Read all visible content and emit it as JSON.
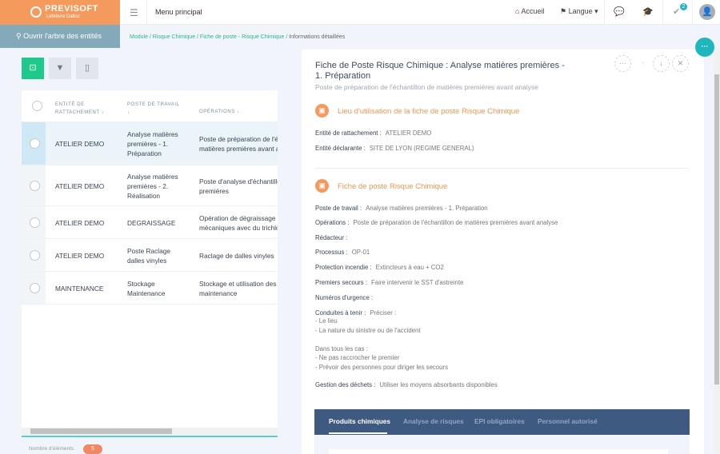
{
  "header": {
    "brand": "PREVISOFT",
    "brand_sub": "Lefebvre Dalloz",
    "menu_label": "Menu principal",
    "home": "Accueil",
    "language": "Langue",
    "notifications_count": "2"
  },
  "toolbar": {
    "tree_button": "Ouvrir l'arbre des entités"
  },
  "breadcrumb": {
    "path": "Module / Risque Chimique / Fiche de poste - Risque Chimique /",
    "current": "Informations détaillées"
  },
  "table": {
    "columns": [
      "ENTITÉ DE",
      "RATTACHEMENT ↓",
      "POSTE DE TRAVAIL",
      "↓",
      "OPÉRATIONS ↓"
    ],
    "rows": [
      {
        "entite": "ATELIER DEMO",
        "poste": [
          "Analyse matières",
          "premières - 1.",
          "Préparation"
        ],
        "ops": [
          "Poste de préparation de l'échantillon de",
          "matières premières avant analyse"
        ]
      },
      {
        "entite": "ATELIER DEMO",
        "poste": [
          "Analyse matières",
          "premières - 2.",
          "Réalisation"
        ],
        "ops": [
          "Poste d'analyse d'échantillons de matières",
          "premières"
        ]
      },
      {
        "entite": "ATELIER DEMO",
        "poste": [
          "DEGRAISSAGE"
        ],
        "ops": [
          "Opération de dégraissage de pièces",
          "mécaniques avec du trichloréthylène"
        ]
      },
      {
        "entite": "ATELIER DEMO",
        "poste": [
          "Poste Raclage",
          "dalles vinyles"
        ],
        "ops": [
          "Raclage de dalles vinyles"
        ]
      },
      {
        "entite": "MAINTENANCE",
        "poste": [
          "Stockage",
          "Maintenance"
        ],
        "ops": [
          "Stockage et utilisation des produits de",
          "maintenance"
        ]
      }
    ],
    "footer_label": "Nombre d'éléments",
    "count": "5"
  },
  "detail": {
    "title": "Fiche de Poste Risque Chimique : Analyse matières premières - 1. Préparation",
    "subtitle": "Poste de préparation de l'échantillon de matières premières avant analyse",
    "section1": "Lieu d'utilisation de la fiche de poste Risque Chimique",
    "s1_fields": [
      {
        "label": "Entité de rattachement :",
        "value": "ATELIER DEMO"
      },
      {
        "label": "Entité déclarante :",
        "value": "SITE DE LYON (REGIME GENERAL)"
      }
    ],
    "section2": "Fiche de poste Risque Chimique",
    "s2_fields": [
      {
        "label": "Poste de travail :",
        "value": "Analyse matières premières - 1. Préparation"
      },
      {
        "label": "Opérations :",
        "value": "Poste de préparation de l'échantillon de matières premières avant analyse"
      },
      {
        "label": "Rédacteur :",
        "value": ""
      },
      {
        "label": "Processus :",
        "value": "OP-01"
      },
      {
        "label": "Protection incendie :",
        "value": "Extincteurs à eau + CO2"
      },
      {
        "label": "Premiers secours :",
        "value": "Faire intervenir le SST d'astreinte"
      },
      {
        "label": "Numéros d'urgence :",
        "value": ""
      },
      {
        "label": "Conduites à tenir :",
        "value": "Préciser :"
      }
    ],
    "conduites_lines": [
      "- Le lieu",
      "- La nature du sinistre ou de l'accident",
      "",
      "Dans tous les cas :",
      "- Ne pas raccrocher le premier",
      "- Prévoir des personnes pour diriger les secours"
    ],
    "dechets": {
      "label": "Gestion des déchets :",
      "value": "Utiliser les moyens absorbants disponibles"
    },
    "tabs": [
      "Produits chimiques",
      "Analyse de risques",
      "EPI obligatoires",
      "Personnel autorisé"
    ]
  }
}
